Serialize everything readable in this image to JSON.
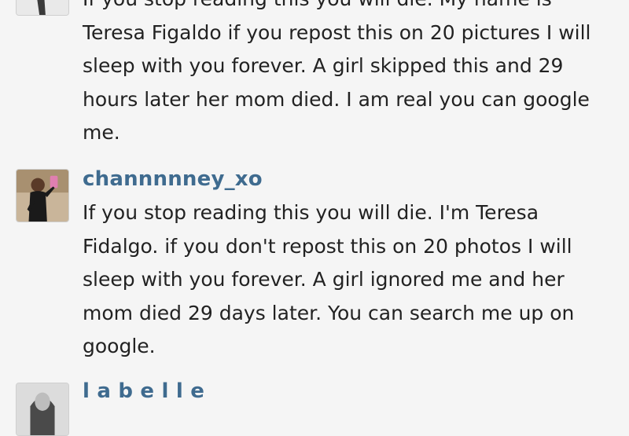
{
  "comments": [
    {
      "username": "",
      "lines": [
        "If you stop reading this you will die. My name is",
        "Teresa Figaldo if you repost this on 20 pictures I will",
        "sleep with you forever. A girl skipped this and 29",
        "hours later her mom died. I am real you can google",
        "me."
      ]
    },
    {
      "username": "channnnney_xo",
      "lines": [
        "If you stop reading this you will die. I'm Teresa",
        "Fidalgo. if you don't repost this on 20 photos I will",
        "sleep with you forever. A girl ignored me and her",
        "mom died 29 days later. You can search me up on",
        "google."
      ]
    },
    {
      "username": "l a b e l l e",
      "lines": []
    }
  ],
  "colors": {
    "background": "#f5f5f5",
    "username": "#3f6b8f",
    "text": "#222222"
  }
}
